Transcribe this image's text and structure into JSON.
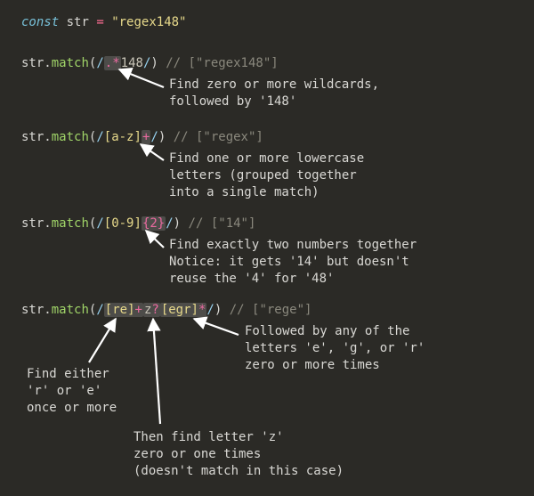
{
  "decl": {
    "kw": "const",
    "name": "str",
    "eq": "=",
    "val": "\"regex148\""
  },
  "ex1": {
    "obj": "str",
    "dot": ".",
    "fn": "match",
    "open": "(",
    "close": ")",
    "sl": "/",
    "pat_dot": ".",
    "pat_q": "*",
    "pat_lit": "148",
    "cm": "// [\"regex148\"]",
    "note_l1": "Find zero or more wildcards,",
    "note_l2": "followed by '148'"
  },
  "ex2": {
    "obj": "str",
    "dot": ".",
    "fn": "match",
    "open": "(",
    "close": ")",
    "sl": "/",
    "ob": "[",
    "cls": "a-z",
    "cb": "]",
    "q": "+",
    "cm": "// [\"regex\"]",
    "note_l1": "Find one or more lowercase",
    "note_l2": "letters (grouped together",
    "note_l3": "into a single match)"
  },
  "ex3": {
    "obj": "str",
    "dot": ".",
    "fn": "match",
    "open": "(",
    "close": ")",
    "sl": "/",
    "ob": "[",
    "cls": "0-9",
    "cb": "]",
    "q": "{2}",
    "cm": "// [\"14\"]",
    "note_l1": "Find exactly two numbers together",
    "note_l2": "Notice: it gets '14' but doesn't",
    "note_l3": "reuse the '4' for '48'"
  },
  "ex4": {
    "obj": "str",
    "dot": ".",
    "fn": "match",
    "open": "(",
    "close": ")",
    "sl": "/",
    "ob": "[",
    "cb": "]",
    "cls1": "re",
    "q1": "+",
    "lit": "z",
    "q2": "?",
    "cls2": "egr",
    "q3": "*",
    "cm": "// [\"rege\"]",
    "noteA_l1": "Find either",
    "noteA_l2": "'r' or 'e'",
    "noteA_l3": "once or more",
    "noteB_l1": "Then find letter 'z'",
    "noteB_l2": "zero or one times",
    "noteB_l3": "(doesn't match in this case)",
    "noteC_l1": "Followed by any of the",
    "noteC_l2": "letters 'e', 'g', or 'r'",
    "noteC_l3": "zero or more times"
  }
}
